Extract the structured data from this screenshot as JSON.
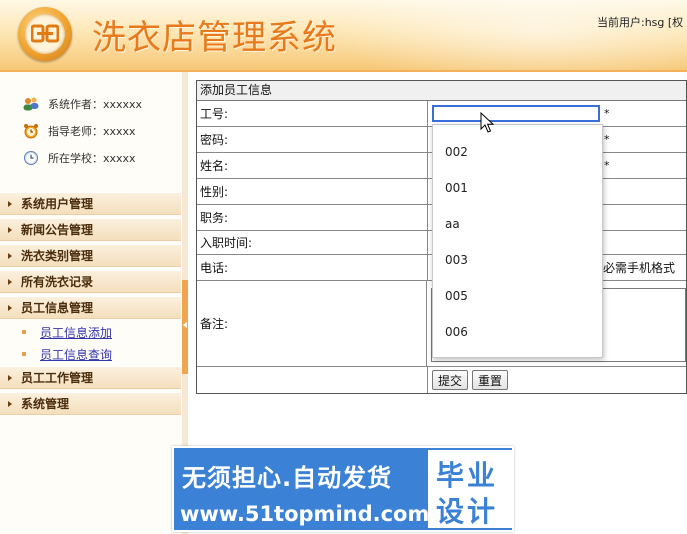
{
  "header": {
    "title": "洗衣店管理系统",
    "current_user": "当前用户:hsg [权"
  },
  "sidebar": {
    "info": [
      {
        "icon": "users-icon",
        "text": "系统作者：xxxxxx"
      },
      {
        "icon": "alarm-clock-icon",
        "text": "指导老师：xxxxx"
      },
      {
        "icon": "clock-icon",
        "text": "所在学校：xxxxx"
      }
    ],
    "menu": [
      {
        "label": "系统用户管理"
      },
      {
        "label": "新闻公告管理"
      },
      {
        "label": "洗衣类别管理"
      },
      {
        "label": "所有洗衣记录"
      },
      {
        "label": "员工信息管理"
      },
      {
        "label": "员工工作管理"
      },
      {
        "label": "系统管理"
      }
    ],
    "submenu": [
      {
        "label": "员工信息添加"
      },
      {
        "label": "员工信息查询"
      }
    ]
  },
  "form": {
    "title": "添加员工信息",
    "fields": {
      "employee_id": {
        "label": "工号:",
        "value": "",
        "required": "*"
      },
      "password": {
        "label": "密码:",
        "required": "*"
      },
      "name": {
        "label": "姓名:",
        "required": "*"
      },
      "gender": {
        "label": "性别:"
      },
      "position": {
        "label": "职务:"
      },
      "hire_date": {
        "label": "入职时间:"
      },
      "phone": {
        "label": "电话:",
        "hint": "必需手机格式"
      },
      "remarks": {
        "label": "备注:"
      }
    },
    "submit_label": "提交",
    "reset_label": "重置"
  },
  "autocomplete": {
    "options": [
      "002",
      "001",
      "aa",
      "003",
      "005",
      "006"
    ]
  },
  "watermark": {
    "line1": "无须担心.自动发货",
    "line2": "www.51topmind.com",
    "box_top": "毕业",
    "box_bottom": "设计"
  },
  "colors": {
    "accent": "#e8791c",
    "menu_text": "#4a2d0c",
    "watermark_blue": "#3b82d6",
    "focus_border": "#3a6fd8"
  }
}
